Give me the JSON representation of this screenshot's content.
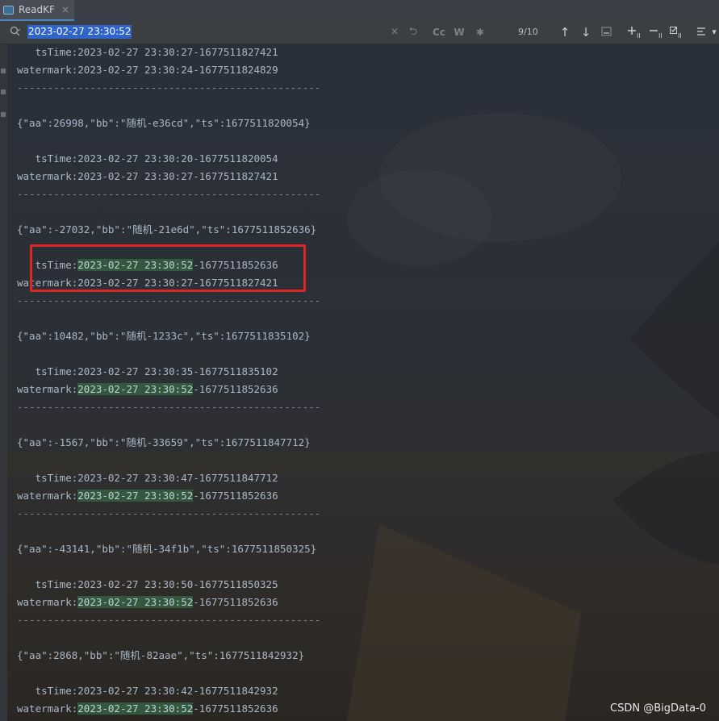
{
  "tab": {
    "title": "ReadKF",
    "close": "×"
  },
  "search": {
    "query": "2023-02-27 23:30:52",
    "match_count": "9/10",
    "icons": {
      "clear": "×",
      "history": "⮌",
      "match_case": "Cc",
      "words": "W",
      "regex": "✱",
      "prev": "↑",
      "next": "↓"
    }
  },
  "colors": {
    "selection": "#2f65ca",
    "match_highlight": "#32593d",
    "annotation_box": "#e02424"
  },
  "lines": [
    {
      "pre": "   tsTime:",
      "hl": "",
      "post": "2023-02-27 23:30:27-1677511827421"
    },
    {
      "pre": "watermark:",
      "hl": "",
      "post": "2023-02-27 23:30:24-1677511824829"
    },
    {
      "pre": "",
      "hl": "",
      "post": "--------------------------------------------------",
      "sep": true
    },
    {
      "pre": "",
      "hl": "",
      "post": ""
    },
    {
      "pre": "",
      "hl": "",
      "post": "{\"aa\":26998,\"bb\":\"随机-e36cd\",\"ts\":1677511820054}"
    },
    {
      "pre": "",
      "hl": "",
      "post": ""
    },
    {
      "pre": "   tsTime:",
      "hl": "",
      "post": "2023-02-27 23:30:20-1677511820054"
    },
    {
      "pre": "watermark:",
      "hl": "",
      "post": "2023-02-27 23:30:27-1677511827421"
    },
    {
      "pre": "",
      "hl": "",
      "post": "--------------------------------------------------",
      "sep": true
    },
    {
      "pre": "",
      "hl": "",
      "post": ""
    },
    {
      "pre": "",
      "hl": "",
      "post": "{\"aa\":-27032,\"bb\":\"随机-21e6d\",\"ts\":1677511852636}"
    },
    {
      "pre": "",
      "hl": "",
      "post": ""
    },
    {
      "pre": "   tsTime:",
      "hl": "2023-02-27 23:30:52",
      "post": "-1677511852636"
    },
    {
      "pre": "watermark:",
      "hl": "",
      "post": "2023-02-27 23:30:27-1677511827421"
    },
    {
      "pre": "",
      "hl": "",
      "post": "--------------------------------------------------",
      "sep": true
    },
    {
      "pre": "",
      "hl": "",
      "post": ""
    },
    {
      "pre": "",
      "hl": "",
      "post": "{\"aa\":10482,\"bb\":\"随机-1233c\",\"ts\":1677511835102}"
    },
    {
      "pre": "",
      "hl": "",
      "post": ""
    },
    {
      "pre": "   tsTime:",
      "hl": "",
      "post": "2023-02-27 23:30:35-1677511835102"
    },
    {
      "pre": "watermark:",
      "hl": "2023-02-27 23:30:52",
      "post": "-1677511852636"
    },
    {
      "pre": "",
      "hl": "",
      "post": "--------------------------------------------------",
      "sep": true
    },
    {
      "pre": "",
      "hl": "",
      "post": ""
    },
    {
      "pre": "",
      "hl": "",
      "post": "{\"aa\":-1567,\"bb\":\"随机-33659\",\"ts\":1677511847712}"
    },
    {
      "pre": "",
      "hl": "",
      "post": ""
    },
    {
      "pre": "   tsTime:",
      "hl": "",
      "post": "2023-02-27 23:30:47-1677511847712"
    },
    {
      "pre": "watermark:",
      "hl": "2023-02-27 23:30:52",
      "post": "-1677511852636"
    },
    {
      "pre": "",
      "hl": "",
      "post": "--------------------------------------------------",
      "sep": true
    },
    {
      "pre": "",
      "hl": "",
      "post": ""
    },
    {
      "pre": "",
      "hl": "",
      "post": "{\"aa\":-43141,\"bb\":\"随机-34f1b\",\"ts\":1677511850325}"
    },
    {
      "pre": "",
      "hl": "",
      "post": ""
    },
    {
      "pre": "   tsTime:",
      "hl": "",
      "post": "2023-02-27 23:30:50-1677511850325"
    },
    {
      "pre": "watermark:",
      "hl": "2023-02-27 23:30:52",
      "post": "-1677511852636"
    },
    {
      "pre": "",
      "hl": "",
      "post": "--------------------------------------------------",
      "sep": true
    },
    {
      "pre": "",
      "hl": "",
      "post": ""
    },
    {
      "pre": "",
      "hl": "",
      "post": "{\"aa\":2868,\"bb\":\"随机-82aae\",\"ts\":1677511842932}"
    },
    {
      "pre": "",
      "hl": "",
      "post": ""
    },
    {
      "pre": "   tsTime:",
      "hl": "",
      "post": "2023-02-27 23:30:42-1677511842932"
    },
    {
      "pre": "watermark:",
      "hl": "2023-02-27 23:30:52",
      "post": "-1677511852636"
    }
  ],
  "footer_watermark": "CSDN @BigData-0"
}
